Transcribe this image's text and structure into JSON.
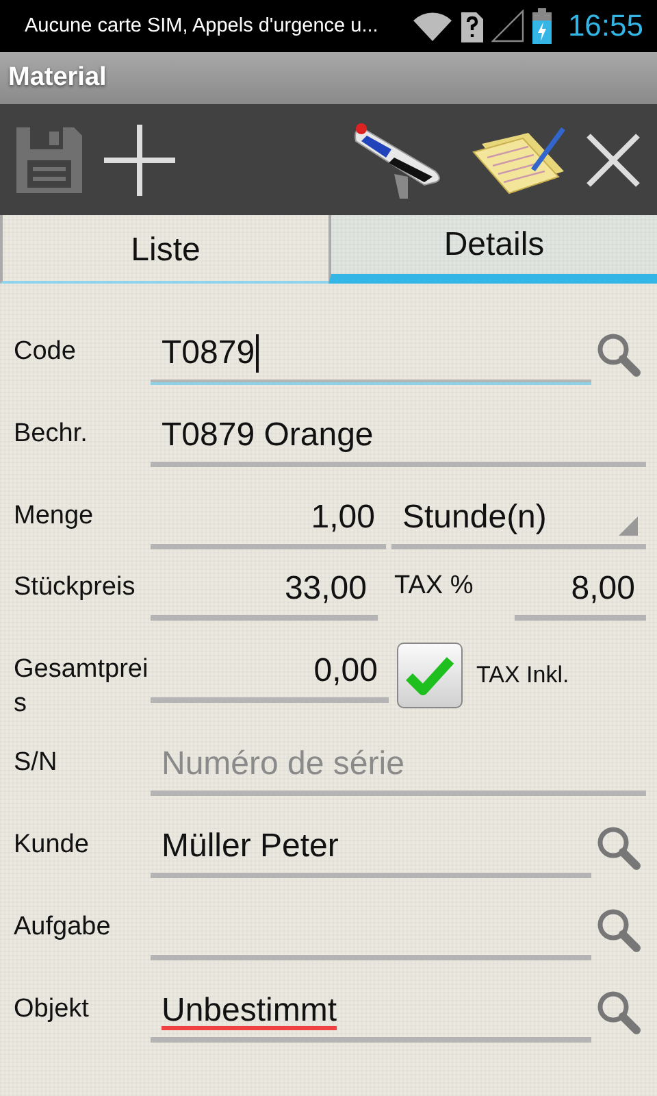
{
  "status_bar": {
    "notification": "Aucune carte SIM, Appels d'urgence u...",
    "time": "16:55"
  },
  "title": "Material",
  "toolbar": {
    "save_disabled": true
  },
  "tabs": [
    {
      "label": "Liste",
      "selected": false
    },
    {
      "label": "Details",
      "selected": true
    }
  ],
  "fields": [
    {
      "kind": "text",
      "label": "Code",
      "value": "T0879",
      "focused": true,
      "lookup": true,
      "spell_error": false
    },
    {
      "kind": "text",
      "label": "Bechr.",
      "value": "T0879 Orange",
      "focused": false,
      "lookup": false,
      "spell_error": false
    },
    {
      "kind": "unit",
      "label": "Menge",
      "value": "1,00",
      "unit": "Stunde(n)",
      "focused": false,
      "lookup": false,
      "spell_error": false
    },
    {
      "kind": "tax",
      "label": "Stückpreis",
      "value": "33,00",
      "tax_label": "TAX %",
      "tax_value": "8,00",
      "focused": false,
      "lookup": false,
      "spell_error": false
    },
    {
      "kind": "check",
      "label": "Gesamtpreis",
      "value": "0,00",
      "check_label": "TAX Inkl.",
      "checked": true,
      "focused": false,
      "lookup": false,
      "spell_error": false
    },
    {
      "kind": "text",
      "label": "S/N",
      "placeholder": "Numéro de série",
      "focused": false,
      "lookup": false,
      "spell_error": false
    },
    {
      "kind": "text",
      "label": "Kunde",
      "value": "Müller Peter",
      "focused": false,
      "lookup": true,
      "spell_error": false
    },
    {
      "kind": "text",
      "label": "Aufgabe",
      "focused": false,
      "lookup": true,
      "spell_error": false
    },
    {
      "kind": "text",
      "label": "Objekt",
      "value": "Unbestimmt",
      "focused": false,
      "lookup": true,
      "spell_error": true
    }
  ]
}
